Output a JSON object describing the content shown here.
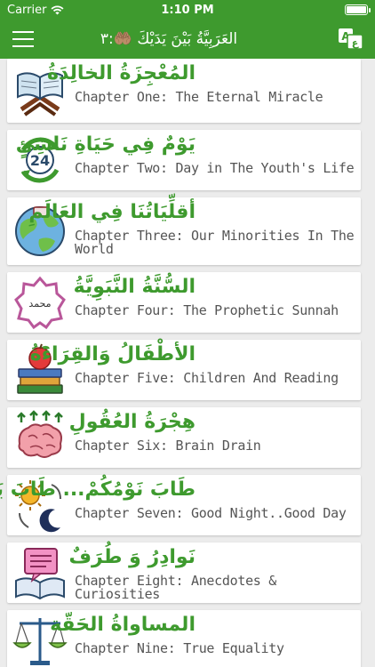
{
  "status_bar": {
    "carrier": "Carrier",
    "time": "1:10 PM",
    "battery_level": 1.0
  },
  "nav_bar": {
    "title": "العَرَبِيَّةُ بَيْنَ يَدَيْكَ 🤲🏽:٣",
    "menu_icon": "hamburger-menu-icon",
    "translate_icon": "translate-icon"
  },
  "chapters": [
    {
      "arabic": "المُعْجِزَةُ الخالِدَةُ",
      "english": "Chapter One: The Eternal Miracle",
      "icon": "open-book-on-stand-icon"
    },
    {
      "arabic": "يَوْمٌ فِي حَيَاةِ نَاشِئٍ",
      "english": "Chapter Two: Day in The Youth's Life",
      "icon": "24-hour-clock-icon"
    },
    {
      "arabic": "أقلِّيَاتُنَا فِي العَالَمِ",
      "english": "Chapter Three: Our Minorities In The World",
      "icon": "globe-icon"
    },
    {
      "arabic": "السُّنَّةُ النَّبَوِيَّةُ",
      "english": "Chapter Four: The Prophetic Sunnah",
      "icon": "muhammad-star-badge-icon",
      "badge_text": "محمد"
    },
    {
      "arabic": "الأطْفَالُ وَالقِرَاءَةُ",
      "english": "Chapter Five: Children And Reading",
      "icon": "apple-on-books-icon"
    },
    {
      "arabic": "هِجْرَةُ العُقُولِ",
      "english": "Chapter Six: Brain Drain",
      "icon": "brain-with-arrows-icon"
    },
    {
      "arabic": "طَابَ نَوْمُكُمْ... طَابَ يَوْمُكُمْ",
      "english": "Chapter Seven: Good Night..Good Day",
      "icon": "sun-and-moon-icon"
    },
    {
      "arabic": "نَوادِرُ وَ طُرَفٌ",
      "english": "Chapter Eight: Anecdotes & Curiosities",
      "icon": "open-book-with-speech-bubble-icon"
    },
    {
      "arabic": "المساواةُ الحَقّة",
      "english": "Chapter Nine: True Equality",
      "icon": "balance-scale-icon"
    }
  ]
}
